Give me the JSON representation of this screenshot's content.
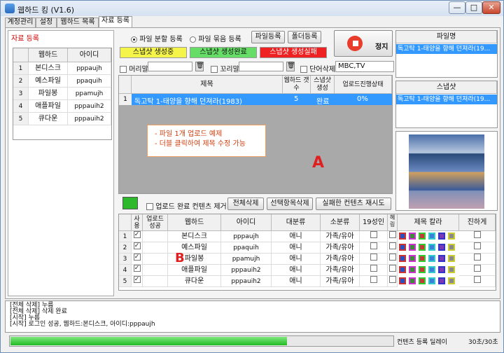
{
  "window": {
    "title": "웹하드 킹 (V1.6)",
    "min": "—",
    "max": "□",
    "close": "✕"
  },
  "tabs": [
    "계정관리",
    "설정",
    "웹하드 목록",
    "자료 등록"
  ],
  "left": {
    "section_label": "자료 등록",
    "headers": [
      "웹하드",
      "아이디"
    ],
    "rows": [
      {
        "num": "1",
        "name": "본디스크",
        "id": "pppaujh"
      },
      {
        "num": "2",
        "name": "예스파일",
        "id": "ppaquih"
      },
      {
        "num": "3",
        "name": "파일봉",
        "id": "ppamujh"
      },
      {
        "num": "4",
        "name": "애플파일",
        "id": "pppauih2"
      },
      {
        "num": "5",
        "name": "큐다운",
        "id": "pppauih2"
      }
    ]
  },
  "top": {
    "radio_split": "파일 분할 등록",
    "radio_bundle": "파일 묶음 등록",
    "file_btn": "파일등록",
    "folder_btn": "폴더등록",
    "stop": "정지",
    "status": {
      "creating": "스냅샷 생성중",
      "complete": "스냅샷 생성완료",
      "failed": "스냅샷 생성실패"
    },
    "header_label": "머리말",
    "footer_label": "꼬리말",
    "bulk_delete_label": "단어삭제",
    "bulk_delete_value": "MBC,TV"
  },
  "list": {
    "headers": {
      "title": "제목",
      "count": "웹하드 갯수",
      "snapshot": "스냅샷 생성",
      "progress": "업로드진행상태"
    },
    "rows": [
      {
        "num": "1",
        "title": "독고탁 1-태양을 향해 던져라(1983)",
        "count": "5",
        "snapshot": "완료",
        "progress": "0%"
      }
    ],
    "callout": [
      "- 파일 1개 업로드 예제",
      "- 더블 클릭하여 제목 수정 가능"
    ],
    "label_a": "A"
  },
  "actions": {
    "remove_done": "업로드 완료 컨텐츠 제거",
    "delete_all": "전체삭제",
    "delete_selected": "선택항목삭제",
    "retry_failed": "실패한 컨텐츠 재시도"
  },
  "bottom": {
    "headers": {
      "use": "사용",
      "done": "업로드 성공",
      "name": "웹하드",
      "id": "아이디",
      "cat1": "대분류",
      "cat2": "소분류",
      "adult": "19성인",
      "hl": "헤링",
      "color": "제목 칼라",
      "bold": "진하게"
    },
    "rows": [
      {
        "num": "1",
        "name": "본디스크",
        "id": "pppaujh",
        "cat1": "애니",
        "cat2": "가족/유아"
      },
      {
        "num": "2",
        "name": "예스파일",
        "id": "ppaquih",
        "cat1": "애니",
        "cat2": "가족/유아"
      },
      {
        "num": "3",
        "name": "파일봉",
        "id": "ppamujh",
        "cat1": "애니",
        "cat2": "가족/유아"
      },
      {
        "num": "4",
        "name": "애플파일",
        "id": "pppauih2",
        "cat1": "애니",
        "cat2": "가족/유아"
      },
      {
        "num": "5",
        "name": "큐다운",
        "id": "pppauih2",
        "cat1": "애니",
        "cat2": "가족/유아"
      }
    ],
    "label_b": "B",
    "swatch_colors": [
      "#2a4fbf",
      "#3d8a3d",
      "#c23b3b",
      "#3b7fd6",
      "#7a3bb0",
      "#888888"
    ]
  },
  "right": {
    "file_header": "파일명",
    "file_value": "독고탁 1-태양을 향해 던져라(19...",
    "snap_header": "스냅샷",
    "snap_value": "독고탁 1-태양을 향해 던져라(19..."
  },
  "log": [
    "[전체 삭제] 누름",
    "[전체 삭제] 삭제 완료",
    "",
    "[시작] 누름",
    "[시작] 로그인 성공, 웹하드:본디스크, 아이디:pppaujh"
  ],
  "statusbar": {
    "delay_label": "컨텐츠 등록 딜레이",
    "delay_value": "30초/30초",
    "progress": 0.72
  }
}
